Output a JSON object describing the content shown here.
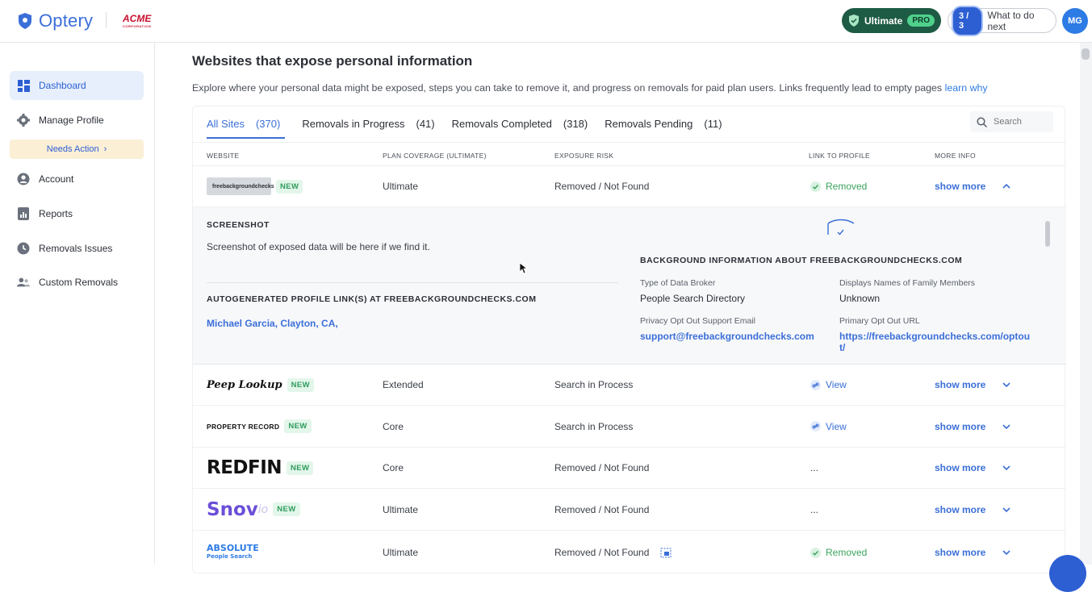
{
  "header": {
    "logo_text": "Optery",
    "partner": "ACME",
    "partner_sub": "CORPORATION",
    "plan_label": "Ultimate",
    "plan_badge": "PRO",
    "progress": "3 / 3",
    "next_label": "What to do next",
    "avatar": "MG"
  },
  "sidebar": {
    "items": [
      {
        "label": "Dashboard",
        "icon": "dashboard-icon"
      },
      {
        "label": "Manage Profile",
        "icon": "gear-icon"
      },
      {
        "label": "Account",
        "icon": "user-icon"
      },
      {
        "label": "Reports",
        "icon": "report-icon"
      },
      {
        "label": "Removals Issues",
        "icon": "clock-icon"
      },
      {
        "label": "Custom Removals",
        "icon": "users-icon"
      }
    ],
    "needs_action": "Needs Action"
  },
  "main": {
    "title": "Websites that expose personal information",
    "description": "Explore where your personal data might be exposed, steps you can take to remove it, and progress on removals for paid plan users. Links frequently lead to empty pages",
    "learn_why": "learn why",
    "tabs": [
      {
        "label": "All Sites",
        "count": "(370)"
      },
      {
        "label": "Removals in Progress",
        "count": "(41)"
      },
      {
        "label": "Removals Completed",
        "count": "(318)"
      },
      {
        "label": "Removals Pending",
        "count": "(11)"
      }
    ],
    "search_placeholder": "Search",
    "columns": [
      "Website",
      "Plan Coverage (Ultimate)",
      "Exposure Risk",
      "Link to Profile",
      "More Info"
    ],
    "rows": [
      {
        "site": "freebackgroundchecks",
        "new": "NEW",
        "plan": "Ultimate",
        "risk": "Removed / Not Found",
        "link": "Removed",
        "more": "show more"
      },
      {
        "site": "Peep Lookup",
        "new": "NEW",
        "plan": "Extended",
        "risk": "Search in Process",
        "link": "View",
        "more": "show more"
      },
      {
        "site": "PROPERTY RECORD",
        "new": "NEW",
        "plan": "Core",
        "risk": "Search in Process",
        "link": "View",
        "more": "show more"
      },
      {
        "site": "REDFIN",
        "new": "NEW",
        "plan": "Core",
        "risk": "Removed / Not Found",
        "link": "...",
        "more": "show more"
      },
      {
        "site": "Snov",
        "new": "NEW",
        "plan": "Ultimate",
        "risk": "Removed / Not Found",
        "link": "...",
        "more": "show more"
      },
      {
        "site": "ABSOLUTE",
        "plan": "Ultimate",
        "risk": "Removed / Not Found",
        "link": "Removed",
        "more": "show more"
      }
    ],
    "expanded": {
      "screenshot_title": "Screenshot",
      "screenshot_text": "Screenshot of exposed data will be here if we find it.",
      "profile_links_title": "Autogenerated Profile Link(s) at freebackgroundchecks.com",
      "profile_link": "Michael Garcia, Clayton, CA,",
      "bg_title": "Background Information about freebackgroundchecks.com",
      "type_label": "Type of Data Broker",
      "type_value": "People Search Directory",
      "family_label": "Displays Names of Family Members",
      "family_value": "Unknown",
      "email_label": "Privacy Opt Out Support Email",
      "email_value": "support@freebackgroundchecks.com",
      "url_label": "Primary Opt Out URL",
      "url_value_1": "https://freebackgroundchecks.com/optou",
      "url_value_2": "t/"
    }
  },
  "colors": {
    "accent": "#3b6fd8",
    "plan_bg": "#1e5b45",
    "success": "#3aa35c"
  }
}
